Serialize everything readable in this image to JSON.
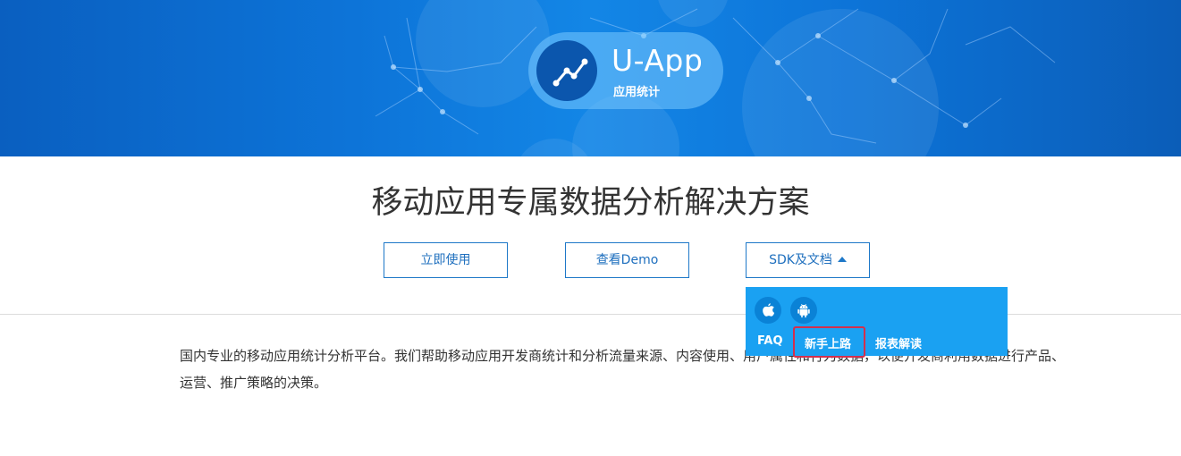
{
  "banner": {
    "app_name": "U-App",
    "app_subtitle": "应用统计",
    "logo_icon": "line-chart-icon",
    "colors": {
      "banner_blue": "#0d74d8",
      "pill": "#78c8ff",
      "logo_circle": "#0b56ad"
    }
  },
  "main": {
    "headline": "移动应用专属数据分析解决方案",
    "buttons": {
      "use_now": "立即使用",
      "view_demo": "查看Demo",
      "sdk_docs": "SDK及文档"
    },
    "description": "国内专业的移动应用统计分析平台。我们帮助移动应用开发商统计和分析流量来源、内容使用、用户属性和行为数据，以便开发商利用数据进行产品、运营、推广策略的决策。"
  },
  "dropdown": {
    "icons": [
      "apple-icon",
      "android-icon"
    ],
    "links": {
      "faq": "FAQ",
      "getting_started": "新手上路",
      "report_guide": "报表解读"
    },
    "colors": {
      "background": "#1aa1f2",
      "highlight_border": "#d32f4d"
    }
  }
}
